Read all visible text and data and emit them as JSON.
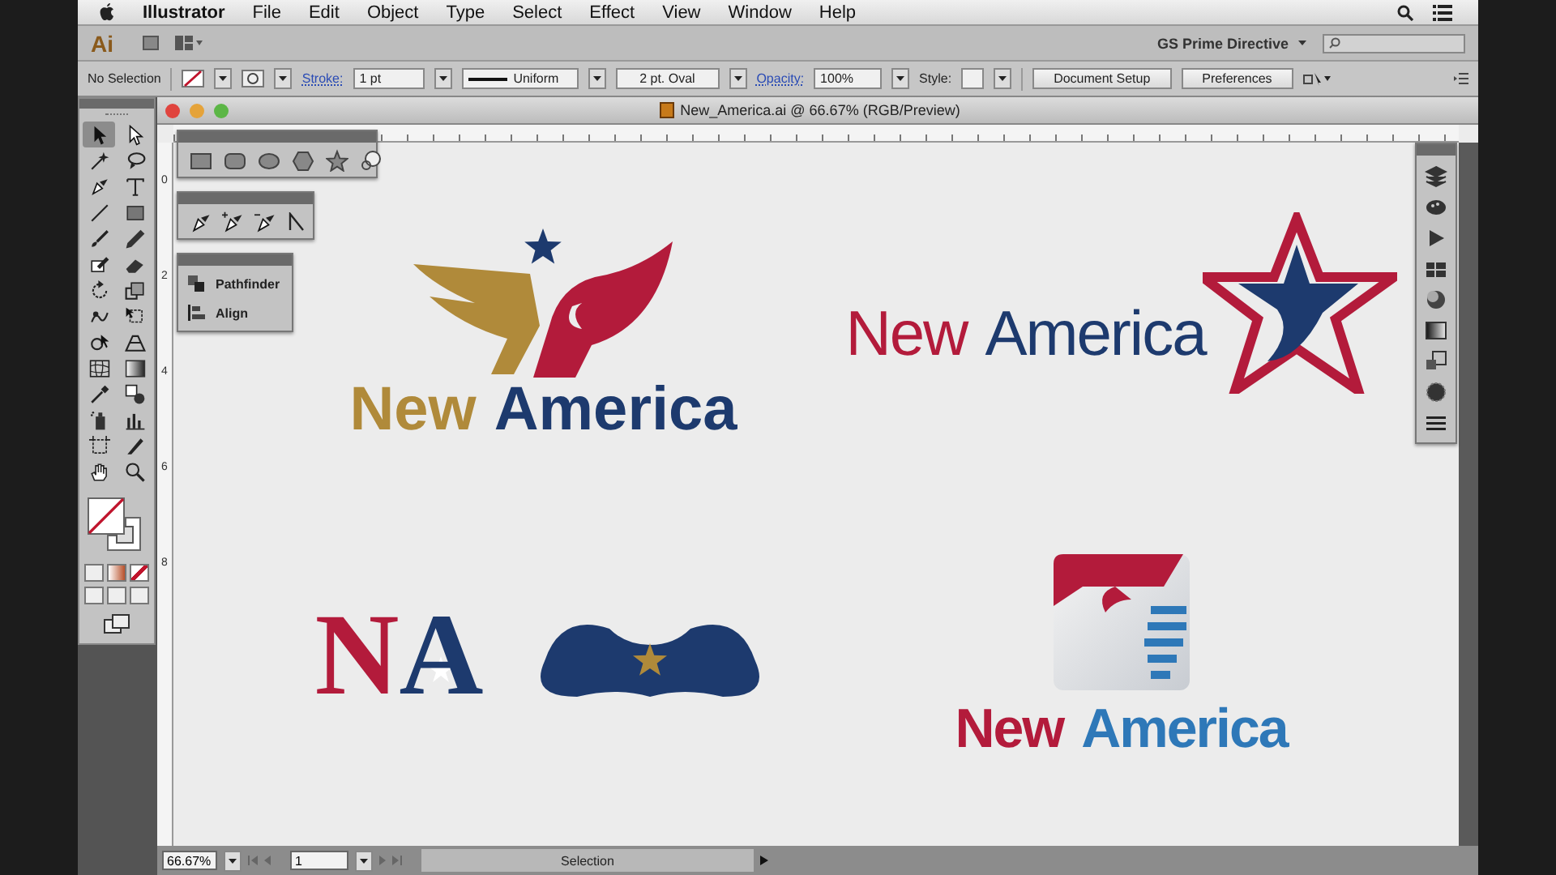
{
  "menu_bar": {
    "app_name": "Illustrator",
    "items": [
      "File",
      "Edit",
      "Object",
      "Type",
      "Select",
      "Effect",
      "View",
      "Window",
      "Help"
    ]
  },
  "app_bar": {
    "logo": "Ai",
    "workspace": "GS Prime Directive"
  },
  "control_bar": {
    "selection": "No Selection",
    "stroke_label": "Stroke:",
    "stroke_weight": "1 pt",
    "stroke_profile": "Uniform",
    "brush": "2 pt. Oval",
    "opacity_label": "Opacity:",
    "opacity": "100%",
    "style_label": "Style:",
    "buttons": [
      "Document Setup",
      "Preferences"
    ]
  },
  "tools": [
    {
      "selected": true
    },
    {
      "selected": false
    },
    {
      "selected": false
    },
    {
      "selected": false
    },
    {
      "selected": false
    },
    {
      "selected": false
    },
    {
      "selected": false
    },
    {
      "selected": false
    },
    {
      "selected": false
    },
    {
      "selected": false
    },
    {
      "selected": false
    },
    {
      "selected": false
    },
    {
      "selected": false
    },
    {
      "selected": false
    },
    {
      "selected": false
    },
    {
      "selected": false
    },
    {
      "selected": false
    },
    {
      "selected": false
    },
    {
      "selected": false
    },
    {
      "selected": false
    },
    {
      "selected": false
    },
    {
      "selected": false
    },
    {
      "selected": false
    },
    {
      "selected": false
    },
    {
      "selected": false
    },
    {
      "selected": false
    },
    {
      "selected": false
    },
    {
      "selected": false
    }
  ],
  "document": {
    "title": "New_America.ai @ 66.67% (RGB/Preview)",
    "ruler_labels": [
      "0",
      "2",
      "4",
      "6",
      "8"
    ]
  },
  "pathfinder_panel": {
    "items": [
      "Pathfinder",
      "Align"
    ]
  },
  "logos": [
    {
      "kind": "wings",
      "words": [
        {
          "text": "New",
          "color": "#b08a3a"
        },
        {
          "text": "America",
          "color": "#1d3a6e"
        }
      ]
    },
    {
      "kind": "star",
      "words": [
        {
          "text": "New",
          "color": "#b31b3b"
        },
        {
          "text": "America",
          "color": "#1d3a6e"
        }
      ]
    },
    {
      "kind": "monogram",
      "words": [
        {
          "text": "N",
          "color": "#b31b3b"
        },
        {
          "text": "A",
          "color": "#1d3a6e"
        }
      ]
    },
    {
      "kind": "badge",
      "words": [
        {
          "text": "New",
          "color": "#b31b3b"
        },
        {
          "text": "America",
          "color": "#2e78b8"
        }
      ]
    }
  ],
  "status_bar": {
    "zoom": "66.67%",
    "artboard": "1",
    "tool": "Selection"
  }
}
